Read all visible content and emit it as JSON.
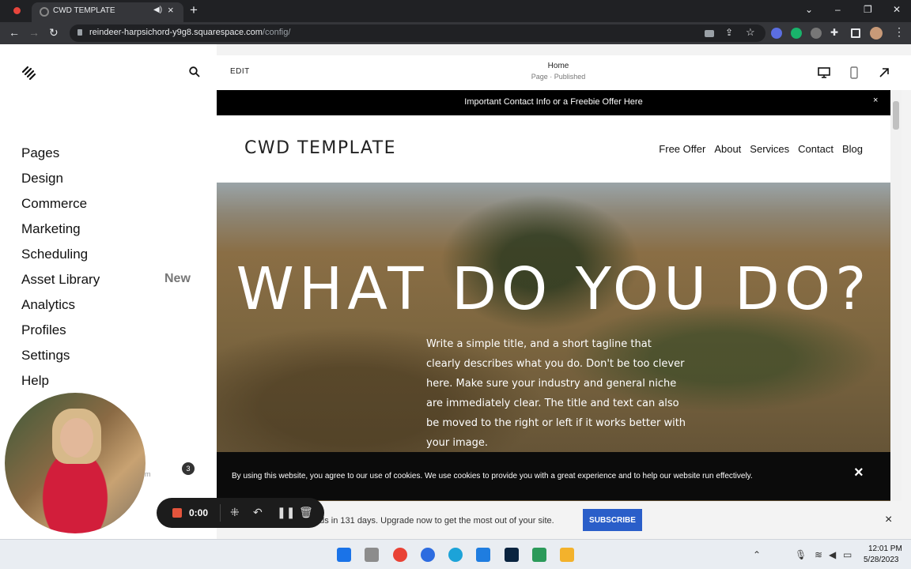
{
  "browser": {
    "tab_title": "CWD TEMPLATE",
    "new_tab": "+",
    "url_host": "reindeer-harpsichord-y9g8.squarespace.com",
    "url_path": "/config/"
  },
  "sidebar": {
    "items": [
      {
        "label": "Pages"
      },
      {
        "label": "Design"
      },
      {
        "label": "Commerce"
      },
      {
        "label": "Marketing"
      },
      {
        "label": "Scheduling"
      },
      {
        "label": "Asset Library"
      },
      {
        "label": "Analytics"
      },
      {
        "label": "Profiles"
      },
      {
        "label": "Settings"
      },
      {
        "label": "Help"
      }
    ],
    "new_badge": "New",
    "notification_count": "3",
    "partial_text": "om"
  },
  "editor": {
    "edit_label": "EDIT",
    "page_title": "Home",
    "page_status": "Page · Published"
  },
  "site": {
    "announcement": "Important Contact Info or a Freebie Offer Here",
    "announcement_close": "×",
    "name": "CWD TEMPLATE",
    "nav": [
      "Free Offer",
      "About",
      "Services",
      "Contact",
      "Blog"
    ],
    "hero_title": "WHAT DO YOU DO?",
    "hero_body": "Write a simple title, and a short tagline that clearly describes what you do. Don't be too clever here. Make sure your industry and general niche are immediately clear. The title and text can also be moved to the right or left if it works better with your image.",
    "cookie_text": "By using this website, you agree to our use of cookies. We use cookies to provide you with a great experience and to help our website run effectively.",
    "cookie_close": "×"
  },
  "trial": {
    "text": "nds in 131 days. Upgrade now to get the most out of your site.",
    "subscribe_label": "SUBSCRIBE",
    "close": "×"
  },
  "recorder": {
    "time": "0:00"
  },
  "taskbar": {
    "time": "12:01 PM",
    "date": "5/28/2023"
  },
  "colors": {
    "subscribe": "#2a5ec9",
    "recorder_stop": "#e4543c",
    "chrome_dark": "#202124"
  }
}
